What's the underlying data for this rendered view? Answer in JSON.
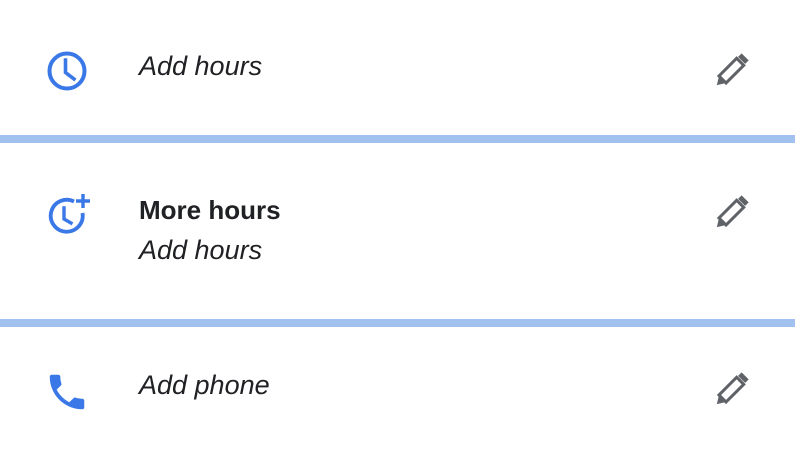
{
  "rows": [
    {
      "icon": "clock-icon",
      "subtitle": "Add hours",
      "edit_icon": "pencil-icon"
    },
    {
      "icon": "clock-plus-icon",
      "title": "More hours",
      "subtitle": "Add hours",
      "edit_icon": "pencil-icon"
    },
    {
      "icon": "phone-icon",
      "subtitle": "Add phone",
      "edit_icon": "pencil-icon"
    }
  ],
  "colors": {
    "accent_icon": "#3b78e7",
    "edit_icon": "#5f6368",
    "divider": "#a1c2ee",
    "text": "#202124"
  }
}
